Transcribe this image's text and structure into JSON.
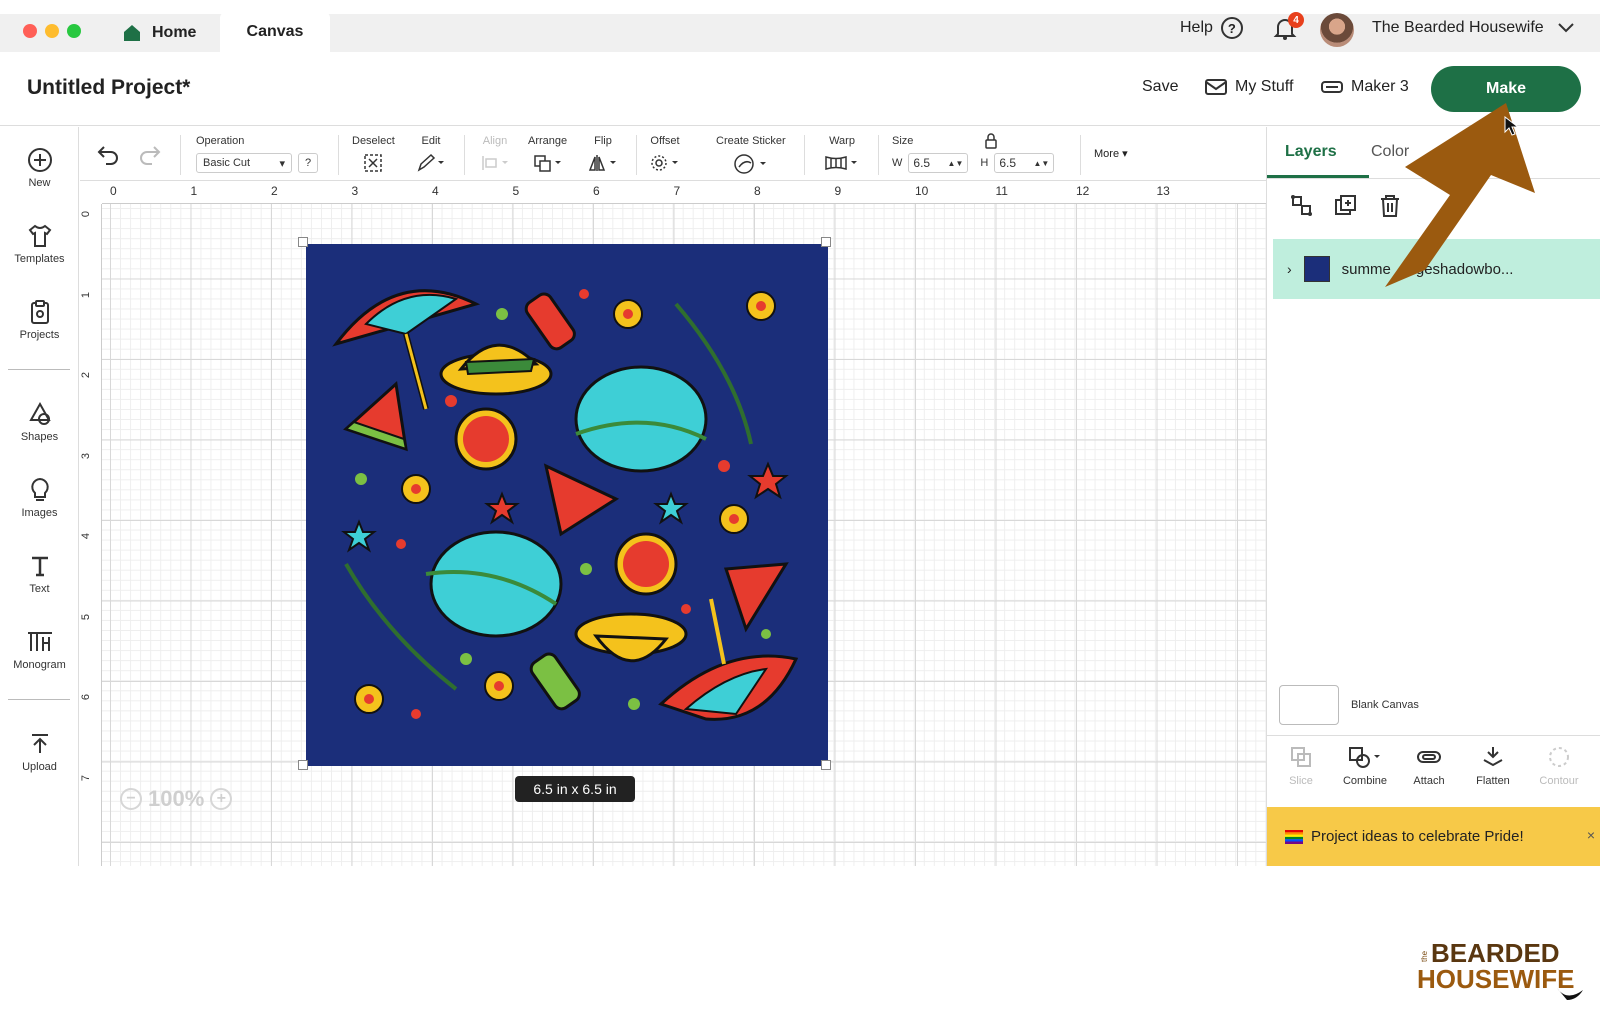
{
  "window": {
    "tabs": {
      "home": "Home",
      "canvas": "Canvas"
    },
    "help_label": "Help",
    "notification_count": "4",
    "username": "The Bearded Housewife"
  },
  "header": {
    "project_title": "Untitled Project*",
    "save_label": "Save",
    "my_stuff_label": "My Stuff",
    "machine_label": "Maker 3",
    "make_label": "Make"
  },
  "sidebar": {
    "items": [
      {
        "label": "New",
        "icon": "plus-circle-icon"
      },
      {
        "label": "Templates",
        "icon": "shirt-icon"
      },
      {
        "label": "Projects",
        "icon": "clipboard-icon"
      },
      {
        "label": "Shapes",
        "icon": "shapes-icon"
      },
      {
        "label": "Images",
        "icon": "lightbulb-icon"
      },
      {
        "label": "Text",
        "icon": "text-icon"
      },
      {
        "label": "Monogram",
        "icon": "monogram-icon"
      },
      {
        "label": "Upload",
        "icon": "upload-icon"
      }
    ]
  },
  "toolbar": {
    "operation_label": "Operation",
    "operation_value": "Basic Cut",
    "operation_help": "?",
    "deselect_label": "Deselect",
    "edit_label": "Edit",
    "align_label": "Align",
    "arrange_label": "Arrange",
    "flip_label": "Flip",
    "offset_label": "Offset",
    "create_sticker_label": "Create Sticker",
    "warp_label": "Warp",
    "size_label": "Size",
    "width_prefix": "W",
    "width_value": "6.5",
    "height_prefix": "H",
    "height_value": "6.5",
    "more_label": "More"
  },
  "canvas": {
    "ruler_h": [
      "0",
      "1",
      "2",
      "3",
      "4",
      "5",
      "6",
      "7",
      "8",
      "9",
      "10",
      "11",
      "12",
      "13"
    ],
    "ruler_v": [
      "0",
      "1",
      "2",
      "3",
      "4",
      "5",
      "6",
      "7"
    ],
    "size_tooltip": "6.5  in x 6.5  in",
    "zoom_label": "100%",
    "design_background": "#1b2e7a"
  },
  "right_panel": {
    "tab_layers": "Layers",
    "tab_color": "Color",
    "layer_name": "summe      geshadowbo...",
    "blank_canvas_label": "Blank Canvas",
    "tools": [
      {
        "label": "Slice",
        "enabled": false
      },
      {
        "label": "Combine",
        "enabled": true
      },
      {
        "label": "Attach",
        "enabled": true
      },
      {
        "label": "Flatten",
        "enabled": true
      },
      {
        "label": "Contour",
        "enabled": false
      }
    ],
    "banner_text": "Project ideas to celebrate Pride!",
    "banner_close": "×"
  },
  "overlay": {
    "logo_line1": "BEARDED",
    "logo_line2": "HOUSEWIFE",
    "logo_small": "the",
    "accent_color": "#1e7046",
    "arrow_color": "#9b5a0f"
  }
}
